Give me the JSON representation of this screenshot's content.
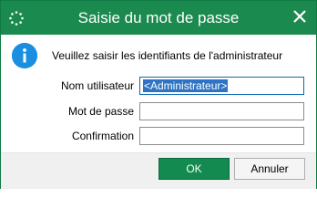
{
  "window": {
    "title": "Saisie du mot de passe",
    "title_bar_color": "#1b8a4f"
  },
  "icons": {
    "app": "dotted-circle-icon",
    "close": "close-icon",
    "info": "info-icon"
  },
  "message": "Veuillez saisir les identifiants de l'administrateur",
  "form": {
    "username_label": "Nom utilisateur",
    "username_value": "<Administrateur>",
    "password_label": "Mot de passe",
    "password_value": "",
    "confirm_label": "Confirmation",
    "confirm_value": ""
  },
  "buttons": {
    "ok_label": "OK",
    "cancel_label": "Annuler"
  }
}
